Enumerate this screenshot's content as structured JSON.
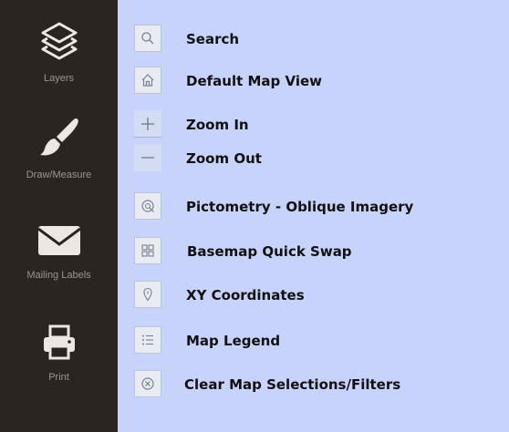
{
  "sidebar": {
    "items": [
      {
        "label": "Layers",
        "icon": "layers-icon"
      },
      {
        "label": "Draw/Measure",
        "icon": "paintbrush-icon"
      },
      {
        "label": "Mailing Labels",
        "icon": "envelope-icon"
      },
      {
        "label": "Print",
        "icon": "printer-icon"
      }
    ]
  },
  "tools": [
    {
      "label": "Search",
      "icon": "search-icon"
    },
    {
      "label": "Default Map View",
      "icon": "home-icon"
    },
    {
      "label": "Zoom In",
      "icon": "plus-icon"
    },
    {
      "label": "Zoom Out",
      "icon": "minus-icon"
    },
    {
      "label": "Pictometry - Oblique Imagery",
      "icon": "pictometry-icon"
    },
    {
      "label": "Basemap Quick Swap",
      "icon": "basemap-grid-icon"
    },
    {
      "label": "XY Coordinates",
      "icon": "location-pin-icon"
    },
    {
      "label": "Map Legend",
      "icon": "list-icon"
    },
    {
      "label": "Clear Map Selections/Filters",
      "icon": "clear-circle-x-icon"
    }
  ],
  "colors": {
    "sidebar_bg": "#2a2521",
    "sidebar_icon": "#ece8e1",
    "sidebar_label": "#9b958e",
    "panel_bg": "#c7d3fb",
    "button_bg": "#e9ebf3",
    "button_border": "#bcc3d6",
    "tool_icon": "#7a8090"
  }
}
